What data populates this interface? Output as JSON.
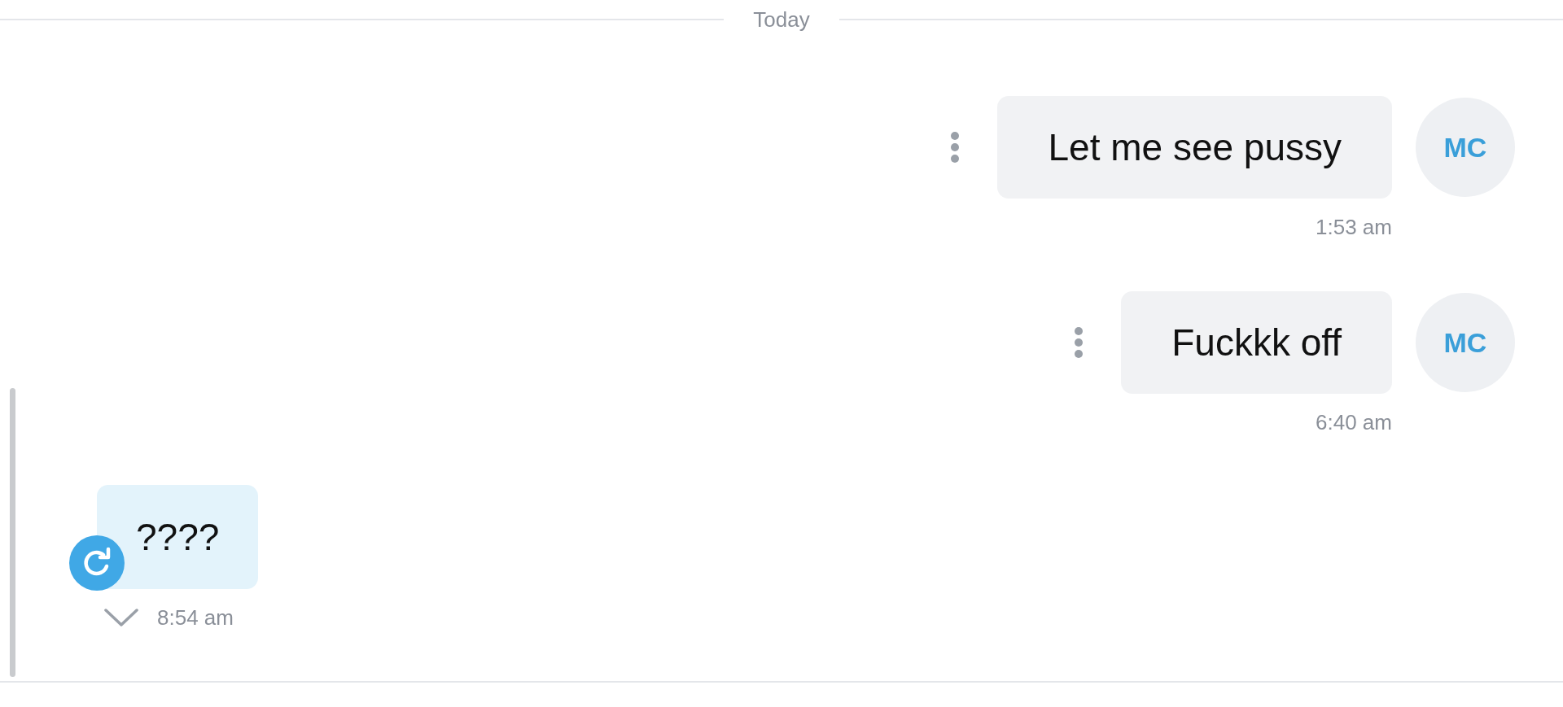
{
  "divider": {
    "label": "Today"
  },
  "messages": [
    {
      "kind": "incoming",
      "avatar": "MC",
      "text": "Let me see pussy",
      "time": "1:53 am"
    },
    {
      "kind": "incoming",
      "avatar": "MC",
      "text": "Fuckkk off",
      "time": "6:40 am"
    },
    {
      "kind": "outgoing",
      "text": "????",
      "time": "8:54 am"
    }
  ]
}
